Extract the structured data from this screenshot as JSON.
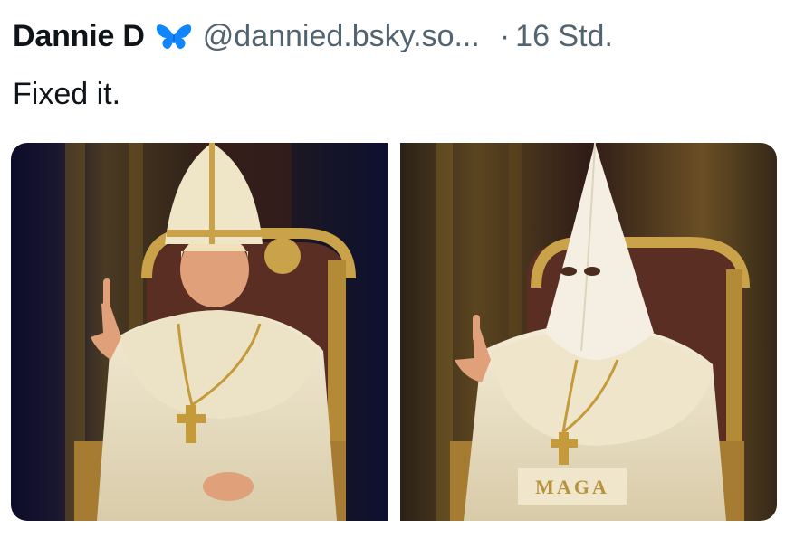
{
  "post": {
    "author_name": "Dannie D",
    "handle": "@dannied.bsky.so...",
    "separator": "·",
    "time": "16 Std.",
    "text": "Fixed it."
  },
  "icons": {
    "verified": "butterfly-icon"
  },
  "media": {
    "left_image": "pope-seated-figure-image",
    "right_image": "hooded-robed-figure-image",
    "right_image_text": "MAGA"
  },
  "colors": {
    "name": "#0f1419",
    "secondary": "#536471",
    "butterfly": "#1185fe"
  }
}
